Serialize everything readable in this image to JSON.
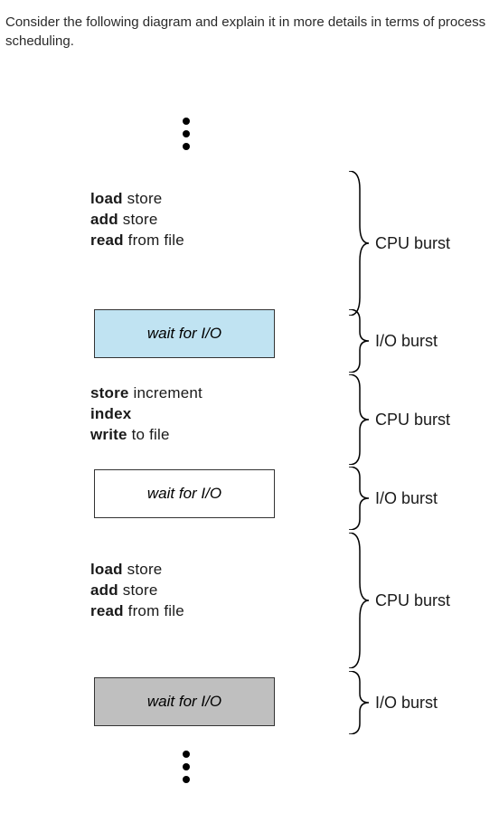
{
  "prompt_text": "Consider the following diagram and explain it in more details in terms of process scheduling.",
  "bursts": {
    "cpu1": {
      "l1a": "load ",
      "l1b": "store",
      "l2a": "add ",
      "l2b": "store",
      "l3a": "read ",
      "l3b": "from file"
    },
    "io1": {
      "text": "wait for I/O"
    },
    "cpu2": {
      "l1a": "store ",
      "l1b": "increment",
      "l2": "index",
      "l3a": "write ",
      "l3b": "to file"
    },
    "io2": {
      "text": "wait for I/O"
    },
    "cpu3": {
      "l1a": "load ",
      "l1b": "store",
      "l2a": "add ",
      "l2b": "store",
      "l3a": "read ",
      "l3b": "from file"
    },
    "io3": {
      "text": "wait for I/O"
    }
  },
  "labels": {
    "cpu": "CPU burst",
    "io": "I/O burst"
  }
}
